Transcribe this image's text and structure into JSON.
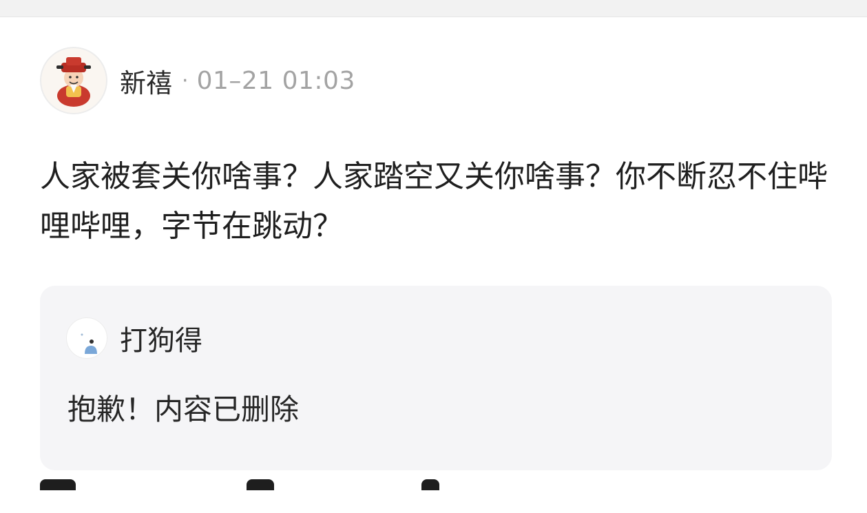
{
  "post": {
    "author": "新禧",
    "separator": "·",
    "timestamp": "01–21 01:03",
    "avatar_icon": "fortune-god-avatar-icon",
    "content": "人家被套关你啥事？人家踏空又关你啥事？你不断忍不住哔哩哔哩，字节在跳动？"
  },
  "quoted": {
    "author": "打狗得",
    "avatar_icon": "default-user-avatar-icon",
    "text": "抱歉！内容已删除"
  },
  "colors": {
    "background": "#ffffff",
    "quote_background": "#f5f5f7",
    "timestamp_gray": "#a3a3a3",
    "text_dark": "#1f1f1f"
  }
}
